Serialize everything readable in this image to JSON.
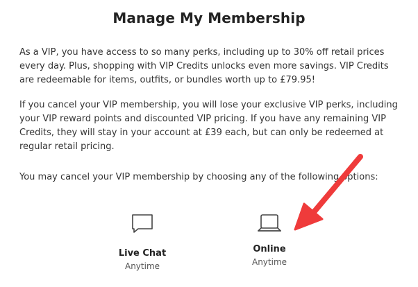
{
  "header": {
    "title": "Manage My Membership"
  },
  "content": {
    "paragraph1": "As a VIP, you have access to so many perks, including up to 30% off retail prices every day. Plus, shopping with VIP Credits unlocks even more savings. VIP Credits are redeemable for items, outfits, or bundles worth up to  £79.95!",
    "paragraph2": "If you cancel your VIP membership, you will lose your exclusive VIP perks, including your VIP reward points and discounted VIP pricing. If you have any remaining VIP Credits, they will stay in your account at £39 each, but can only be redeemed at regular retail pricing.",
    "paragraph3": "You may cancel your VIP membership by choosing any of the following options:"
  },
  "options": [
    {
      "label": "Live Chat",
      "sub": "Anytime",
      "icon": "chat-bubble-icon"
    },
    {
      "label": "Online",
      "sub": "Anytime",
      "icon": "laptop-icon"
    }
  ],
  "colors": {
    "annotation_arrow": "#ef3b3b",
    "text": "#333333",
    "icon_stroke": "#444444"
  }
}
